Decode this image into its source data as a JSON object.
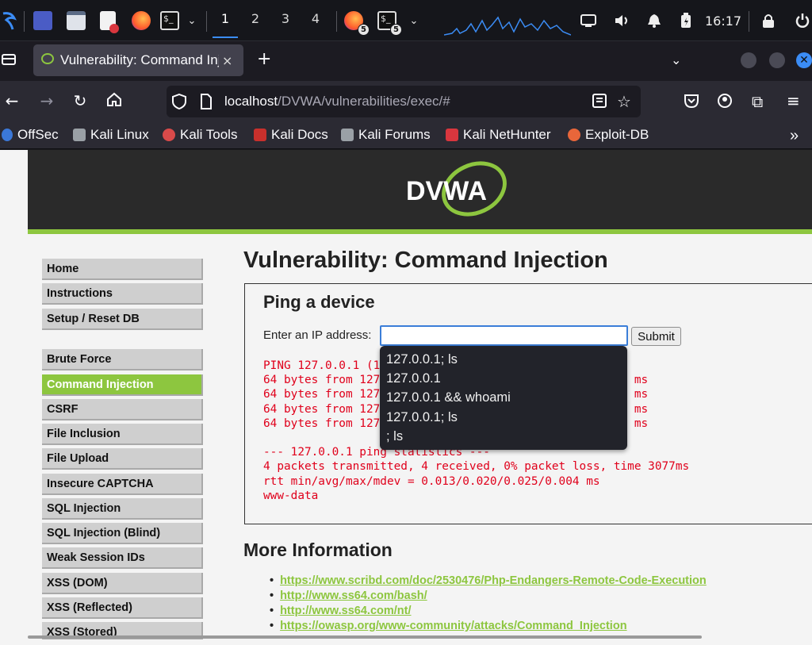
{
  "taskbar": {
    "workspaces": [
      "1",
      "2",
      "3",
      "4"
    ],
    "firefox_badge": "5",
    "terminal_badge": "5",
    "clock": "16:17"
  },
  "browser": {
    "tab_title": "Vulnerability: Command Injection",
    "tab_close": "×",
    "new_tab": "+",
    "url_host": "localhost",
    "url_path": "/DVWA/vulnerabilities/exec/#"
  },
  "bookmarks": [
    {
      "label": "OffSec",
      "color": "#3b78d8"
    },
    {
      "label": "Kali Linux",
      "color": "#9aa0a6"
    },
    {
      "label": "Kali Tools",
      "color": "#d94a4a"
    },
    {
      "label": "Kali Docs",
      "color": "#c9302c"
    },
    {
      "label": "Kali Forums",
      "color": "#9aa0a6"
    },
    {
      "label": "Kali NetHunter",
      "color": "#d9363e"
    },
    {
      "label": "Exploit-DB",
      "color": "#e8663a"
    }
  ],
  "page": {
    "logo_text": "DVWA",
    "menu": [
      "Home",
      "Instructions",
      "Setup / Reset DB",
      "Brute Force",
      "Command Injection",
      "CSRF",
      "File Inclusion",
      "File Upload",
      "Insecure CAPTCHA",
      "SQL Injection",
      "SQL Injection (Blind)",
      "Weak Session IDs",
      "XSS (DOM)",
      "XSS (Reflected)",
      "XSS (Stored)"
    ],
    "selected_menu": "Command Injection",
    "title": "Vulnerability: Command Injection",
    "box_title": "Ping a device",
    "ip_label": "Enter an IP address:",
    "ip_value": "",
    "submit_label": "Submit",
    "output_lines": [
      "PING 127.0.0.1 (127.0.0.1) 56(84) bytes of data.",
      "64 bytes from 127.0.0.1: icmp_seq=1 ttl=64 time=0.013 ms",
      "64 bytes from 127.0.0.1: icmp_seq=2 ttl=64 time=0.025 ms",
      "64 bytes from 127.0.0.1: icmp_seq=3 ttl=64 time=0.022 ms",
      "64 bytes from 127.0.0.1: icmp_seq=4 ttl=64 time=0.020 ms",
      "",
      "--- 127.0.0.1 ping statistics ---",
      "4 packets transmitted, 4 received, 0% packet loss, time 3077ms",
      "rtt min/avg/max/mdev = 0.013/0.020/0.025/0.004 ms",
      "www-data"
    ],
    "autocomplete": [
      "127.0.0.1; ls",
      "127.0.0.1",
      "127.0.0.1 && whoami",
      "127.0.0.1; ls",
      "; ls"
    ],
    "more_info_title": "More Information",
    "links": [
      "https://www.scribd.com/doc/2530476/Php-Endangers-Remote-Code-Execution",
      "http://www.ss64.com/bash/",
      "http://www.ss64.com/nt/",
      "https://owasp.org/www-community/attacks/Command_Injection"
    ]
  },
  "colors": {
    "accent_green": "#8dc63f",
    "output_red": "#e0001b",
    "header_bg": "#2a2a2a"
  }
}
